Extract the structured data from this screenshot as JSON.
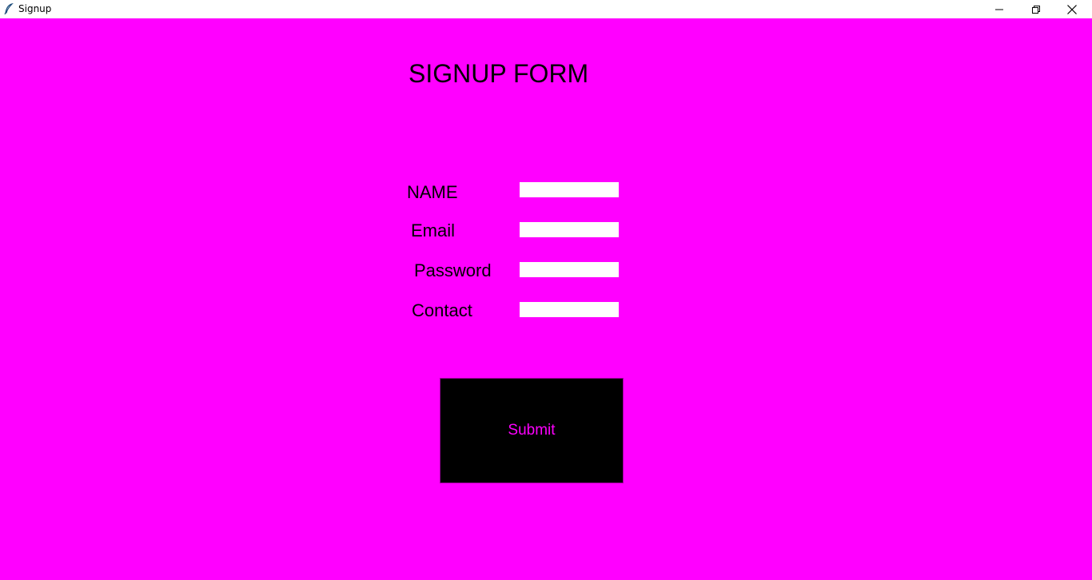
{
  "window": {
    "title": "Signup",
    "background": "#ff00ff",
    "controls": [
      "minimize-icon",
      "restore-icon",
      "close-icon"
    ]
  },
  "form": {
    "title": "SIGNUP FORM",
    "fields": [
      {
        "label": "NAME",
        "value": ""
      },
      {
        "label": "Email",
        "value": ""
      },
      {
        "label": "Password",
        "value": ""
      },
      {
        "label": "Contact",
        "value": ""
      }
    ],
    "submit_label": "Submit",
    "submit_bg": "#000000",
    "submit_fg": "#ff00ff"
  }
}
